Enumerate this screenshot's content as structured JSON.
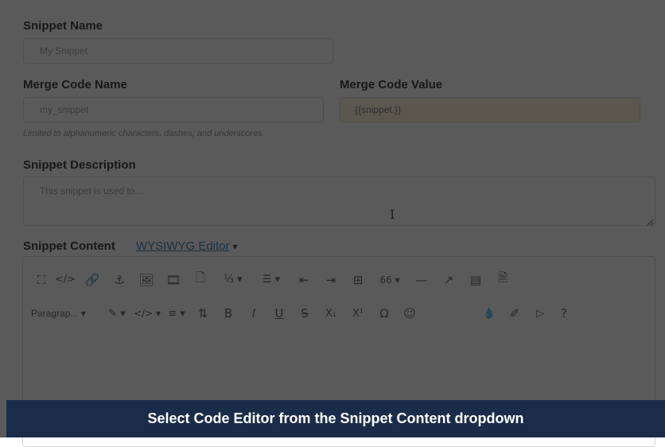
{
  "form": {
    "snippet_name": {
      "label": "Snippet Name",
      "placeholder": "My Snippet"
    },
    "merge_code_name": {
      "label": "Merge Code Name",
      "placeholder": "my_snippet",
      "hint": "Limited to alphanumeric characters, dashes, and underscores"
    },
    "merge_code_value": {
      "label": "Merge Code Value",
      "value": "{{snippet.}}"
    },
    "snippet_description": {
      "label": "Snippet Description",
      "placeholder": "This snippet is used to..."
    },
    "snippet_content": {
      "label": "Snippet Content",
      "editor_mode": "WYSIWYG Editor",
      "editor_caret": "▾"
    }
  },
  "toolbar": {
    "row1": [
      {
        "name": "fullscreen-icon",
        "glyph": "⛶"
      },
      {
        "name": "source-code-icon",
        "glyph": "</>"
      },
      {
        "name": "link-icon",
        "glyph": "🔗"
      },
      {
        "name": "anchor-icon",
        "glyph": "⚓"
      },
      {
        "name": "image-icon",
        "glyph": "🖼"
      },
      {
        "name": "media-icon",
        "glyph": "🎞"
      },
      {
        "name": "template-icon",
        "glyph": "🗋"
      },
      {
        "name": "numbered-list-icon",
        "glyph": "⅓ ▾"
      },
      {
        "name": "bullet-list-icon",
        "glyph": "☰ ▾"
      },
      {
        "name": "outdent-icon",
        "glyph": "⇤"
      },
      {
        "name": "indent-icon",
        "glyph": "⇥"
      },
      {
        "name": "table-icon",
        "glyph": "⊞"
      },
      {
        "name": "blockquote-icon",
        "glyph": "66 ▾"
      },
      {
        "name": "horizontal-line-icon",
        "glyph": "—"
      },
      {
        "name": "external-link-icon",
        "glyph": "↗"
      },
      {
        "name": "page-icon",
        "glyph": "▤"
      },
      {
        "name": "document-icon",
        "glyph": "🗎"
      }
    ],
    "row2": [
      {
        "name": "paragraph-format-dropdown",
        "glyph": "Paragrap... ▾"
      },
      {
        "name": "text-color-icon",
        "glyph": "✎ ▾"
      },
      {
        "name": "code-format-icon",
        "glyph": "</> ▾"
      },
      {
        "name": "align-icon",
        "glyph": "≡ ▾"
      },
      {
        "name": "line-height-icon",
        "glyph": "⇅"
      },
      {
        "name": "bold-icon",
        "glyph": "B"
      },
      {
        "name": "italic-icon",
        "glyph": "I"
      },
      {
        "name": "underline-icon",
        "glyph": "U"
      },
      {
        "name": "strikethrough-icon",
        "glyph": "S"
      },
      {
        "name": "subscript-icon",
        "glyph": "X₁"
      },
      {
        "name": "superscript-icon",
        "glyph": "X¹"
      },
      {
        "name": "special-char-icon",
        "glyph": "Ω"
      },
      {
        "name": "emoji-icon",
        "glyph": "☺"
      },
      {
        "name": "undo-icon",
        "glyph": ""
      },
      {
        "name": "redo-icon",
        "glyph": ""
      },
      {
        "name": "fill-color-icon",
        "glyph": "💧"
      },
      {
        "name": "highlight-icon",
        "glyph": "✐"
      },
      {
        "name": "pointer-icon",
        "glyph": "▷"
      },
      {
        "name": "help-icon",
        "glyph": "?"
      }
    ]
  },
  "banner": {
    "text": "Select Code Editor from the Snippet Content dropdown"
  },
  "colors": {
    "banner_bg": "#1b2c4a",
    "link": "#2a7ab8",
    "readonly_field": "#fdf7d8"
  }
}
